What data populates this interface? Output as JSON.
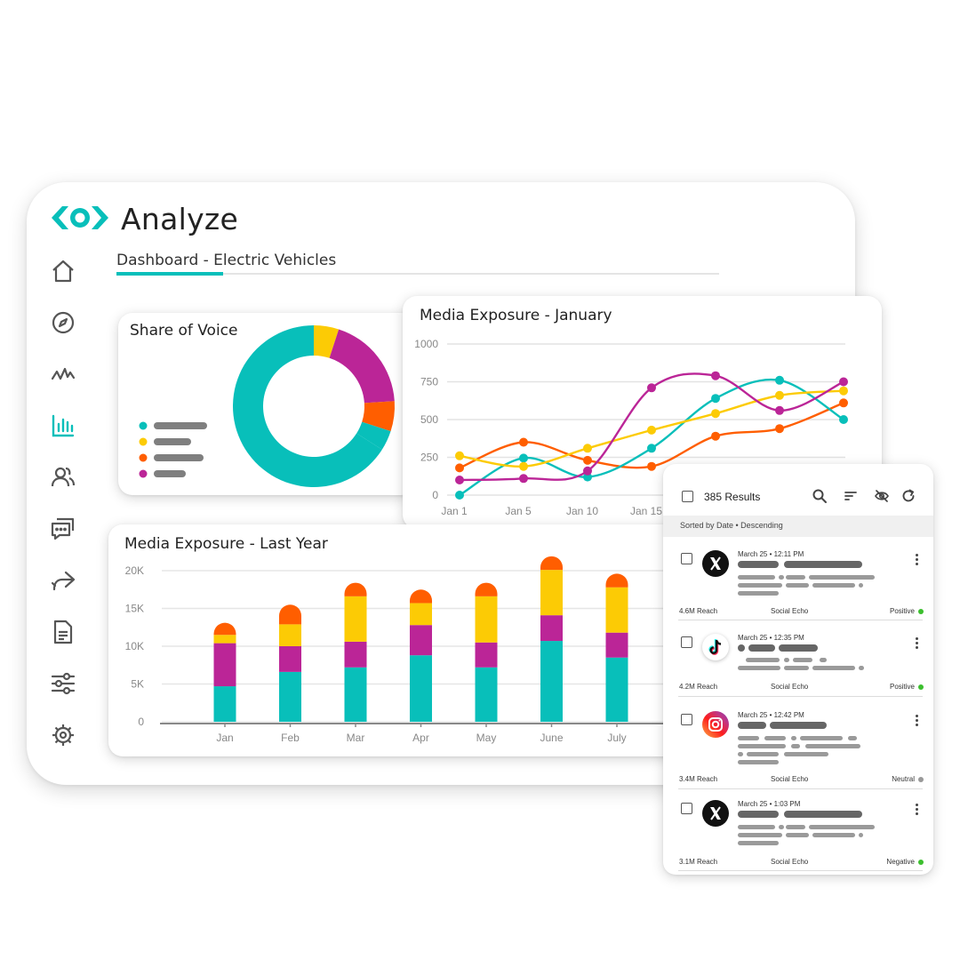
{
  "app": {
    "title": "Analyze"
  },
  "breadcrumb": {
    "text": "Dashboard -  Electric Vehicles"
  },
  "sidebar": {
    "items": [
      {
        "icon": "home-icon"
      },
      {
        "icon": "compass-icon"
      },
      {
        "icon": "activity-icon"
      },
      {
        "icon": "bar-chart-icon",
        "active": true
      },
      {
        "icon": "users-icon"
      },
      {
        "icon": "chat-icon"
      },
      {
        "icon": "share-icon"
      },
      {
        "icon": "document-icon"
      },
      {
        "icon": "sliders-icon"
      },
      {
        "icon": "settings-icon"
      }
    ]
  },
  "colors": {
    "teal": "#08bfba",
    "yellow": "#fccb05",
    "magenta": "#bb2597",
    "orange": "#ff5e00",
    "inactive_icon": "#555555",
    "positive": "#3cbf2e",
    "neutral": "#999999"
  },
  "share_of_voice": {
    "title": "Share of Voice",
    "chart_data": {
      "type": "pie",
      "slices": [
        {
          "color": "#08bfba",
          "value": 66
        },
        {
          "color": "#fccb05",
          "value": 5
        },
        {
          "color": "#bb2597",
          "value": 19
        },
        {
          "color": "#ff5e00",
          "value": 6
        },
        {
          "color": "#08bfba",
          "value": 4
        }
      ],
      "legend_colors": [
        "#08bfba",
        "#fccb05",
        "#ff5e00",
        "#bb2597"
      ]
    }
  },
  "media_january": {
    "title": "Media Exposure - January",
    "chart_data": {
      "type": "line",
      "x": [
        "Jan 1",
        "Jan 5",
        "Jan 10",
        "Jan 15",
        "",
        "",
        "",
        ""
      ],
      "x_ticks": [
        "Jan 1",
        "Jan 5",
        "Jan 10",
        "Jan 15"
      ],
      "ylim": [
        0,
        1000
      ],
      "yticks": [
        0,
        250,
        500,
        750,
        1000
      ],
      "series": [
        {
          "color": "#08bfba",
          "values": [
            0,
            245,
            120,
            310,
            640,
            760,
            500
          ]
        },
        {
          "color": "#fccb05",
          "values": [
            260,
            190,
            310,
            430,
            540,
            660,
            690
          ]
        },
        {
          "color": "#bb2597",
          "values": [
            100,
            110,
            160,
            710,
            790,
            560,
            750
          ]
        },
        {
          "color": "#ff5e00",
          "values": [
            180,
            350,
            230,
            190,
            390,
            440,
            610
          ]
        }
      ],
      "x_index": [
        0,
        1,
        2,
        3,
        4,
        5,
        6
      ]
    }
  },
  "media_year": {
    "title": "Media Exposure - Last Year",
    "chart_data": {
      "type": "bar",
      "categories": [
        "Jan",
        "Feb",
        "Mar",
        "Apr",
        "May",
        "June",
        "July"
      ],
      "ylim": [
        0,
        20000
      ],
      "yticks": [
        "0",
        "5K",
        "10K",
        "15K",
        "20K"
      ],
      "ytick_values": [
        0,
        5000,
        10000,
        15000,
        20000
      ],
      "series": [
        {
          "color": "#08bfba",
          "values": [
            4700,
            6600,
            7200,
            8800,
            7200,
            10700,
            8500
          ]
        },
        {
          "color": "#bb2597",
          "values": [
            5700,
            3400,
            3400,
            4000,
            3300,
            3400,
            3300
          ]
        },
        {
          "color": "#fccb05",
          "values": [
            1100,
            2900,
            6000,
            2900,
            6100,
            6000,
            6000
          ]
        },
        {
          "color": "#ff5e00",
          "values": [
            1600,
            2600,
            1800,
            1800,
            1800,
            1800,
            1800
          ]
        }
      ]
    }
  },
  "results": {
    "count": "385 Results",
    "sort_text": "Sorted by Date • Descending",
    "posts": [
      {
        "network": "x",
        "timestamp": "March 25 • 12:11 PM",
        "reach": "4.6M Reach",
        "source": "Social Echo",
        "sentiment": "Positive",
        "sentiment_color": "#3cbf2e"
      },
      {
        "network": "tiktok",
        "timestamp": "March 25 • 12:35 PM",
        "reach": "4.2M Reach",
        "source": "Social Echo",
        "sentiment": "Positive",
        "sentiment_color": "#3cbf2e"
      },
      {
        "network": "instagram",
        "timestamp": "March 25 • 12:42 PM",
        "reach": "3.4M Reach",
        "source": "Social Echo",
        "sentiment": "Neutral",
        "sentiment_color": "#999999"
      },
      {
        "network": "x",
        "timestamp": "March 25 • 1:03 PM",
        "reach": "3.1M Reach",
        "source": "Social Echo",
        "sentiment": "Negative",
        "sentiment_color": "#3cbf2e"
      }
    ]
  }
}
